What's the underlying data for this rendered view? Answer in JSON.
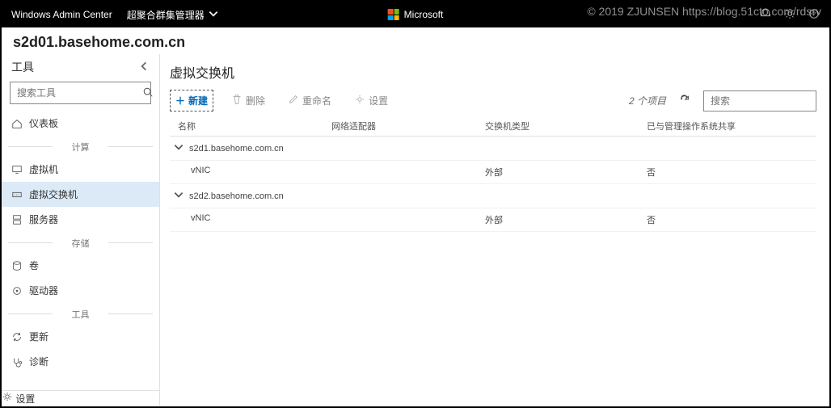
{
  "watermark": "© 2019 ZJUNSEN https://blog.51cto.com/rdsrv",
  "topbar": {
    "product": "Windows Admin Center",
    "manager": "超聚合群集管理器",
    "ms_label": "Microsoft"
  },
  "host": "s2d01.basehome.com.cn",
  "sidebar": {
    "title": "工具",
    "search_placeholder": "搜索工具",
    "items": {
      "dashboard": "仪表板",
      "group_compute": "计算",
      "vm": "虚拟机",
      "vswitch": "虚拟交换机",
      "servers": "服务器",
      "group_storage": "存储",
      "volumes": "卷",
      "drives": "驱动器",
      "group_tools": "工具",
      "updates": "更新",
      "diagnostics": "诊断"
    },
    "settings": "设置"
  },
  "main": {
    "title": "虚拟交换机",
    "toolbar": {
      "new": "新建",
      "delete": "删除",
      "rename": "重命名",
      "settings": "设置",
      "count": "2 个项目",
      "search_placeholder": "搜索"
    },
    "columns": {
      "name": "名称",
      "adapter": "网络适配器",
      "type": "交换机类型",
      "share": "已与管理操作系统共享"
    },
    "groups": [
      {
        "host": "s2d1.basehome.com.cn",
        "rows": [
          {
            "name": "vNIC",
            "adapter": "",
            "type": "外部",
            "share": "否"
          }
        ]
      },
      {
        "host": "s2d2.basehome.com.cn",
        "rows": [
          {
            "name": "vNIC",
            "adapter": "",
            "type": "外部",
            "share": "否"
          }
        ]
      }
    ]
  }
}
